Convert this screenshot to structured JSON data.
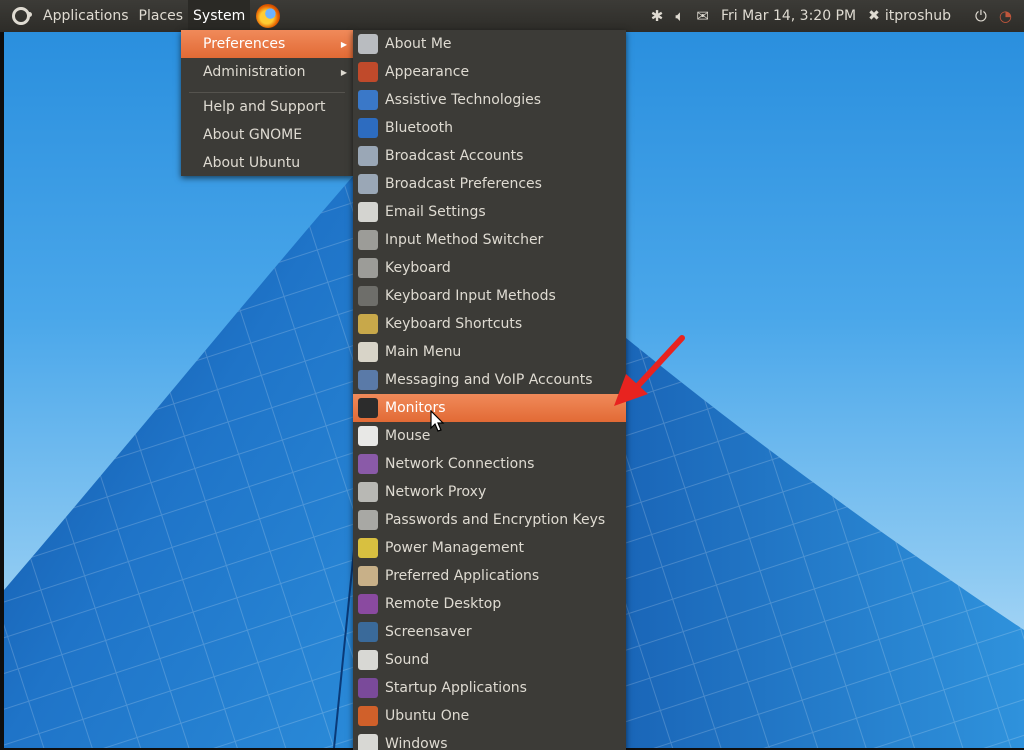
{
  "panel": {
    "applications": "Applications",
    "places": "Places",
    "system": "System",
    "datetime": "Fri Mar 14,  3:20 PM",
    "user": "itproshub"
  },
  "system_menu": {
    "items": [
      {
        "label": "Preferences",
        "has_submenu": true,
        "highlighted": true
      },
      {
        "label": "Administration",
        "has_submenu": true
      },
      {
        "label": "Help and Support"
      },
      {
        "label": "About GNOME"
      },
      {
        "label": "About Ubuntu"
      }
    ]
  },
  "preferences_menu": {
    "items": [
      {
        "label": "About Me",
        "icon": "user-icon",
        "color": "#b9bcc0"
      },
      {
        "label": "Appearance",
        "icon": "appearance-icon",
        "color": "#c04a2b"
      },
      {
        "label": "Assistive Technologies",
        "icon": "accessibility-icon",
        "color": "#3a78c8"
      },
      {
        "label": "Bluetooth",
        "icon": "bluetooth-icon",
        "color": "#2d6cc0"
      },
      {
        "label": "Broadcast Accounts",
        "icon": "broadcast-icon",
        "color": "#9aa7b6"
      },
      {
        "label": "Broadcast Preferences",
        "icon": "broadcast-icon",
        "color": "#9aa7b6"
      },
      {
        "label": "Email Settings",
        "icon": "email-icon",
        "color": "#d4d4d0"
      },
      {
        "label": "Input Method Switcher",
        "icon": "keyboard-icon",
        "color": "#9c9c98"
      },
      {
        "label": "Keyboard",
        "icon": "keyboard-icon",
        "color": "#9c9c98"
      },
      {
        "label": "Keyboard Input Methods",
        "icon": "info-icon",
        "color": "#6e6e6a"
      },
      {
        "label": "Keyboard Shortcuts",
        "icon": "shortcuts-icon",
        "color": "#c8a84a"
      },
      {
        "label": "Main Menu",
        "icon": "main-menu-icon",
        "color": "#d8d4c8"
      },
      {
        "label": "Messaging and VoIP Accounts",
        "icon": "messaging-icon",
        "color": "#5a7aa8"
      },
      {
        "label": "Monitors",
        "icon": "monitor-icon",
        "color": "#2c2c2c",
        "highlighted": true
      },
      {
        "label": "Mouse",
        "icon": "mouse-icon",
        "color": "#e8e8e6"
      },
      {
        "label": "Network Connections",
        "icon": "network-icon",
        "color": "#8a5aa8"
      },
      {
        "label": "Network Proxy",
        "icon": "proxy-icon",
        "color": "#b8b8b4"
      },
      {
        "label": "Passwords and Encryption Keys",
        "icon": "keys-icon",
        "color": "#a8a8a4"
      },
      {
        "label": "Power Management",
        "icon": "power-icon",
        "color": "#d8c040"
      },
      {
        "label": "Preferred Applications",
        "icon": "preferred-apps-icon",
        "color": "#c8b088"
      },
      {
        "label": "Remote Desktop",
        "icon": "remote-desktop-icon",
        "color": "#8a4aa0"
      },
      {
        "label": "Screensaver",
        "icon": "screensaver-icon",
        "color": "#3a6a9a"
      },
      {
        "label": "Sound",
        "icon": "sound-icon",
        "color": "#d8d8d4"
      },
      {
        "label": "Startup Applications",
        "icon": "startup-icon",
        "color": "#7a4a9a"
      },
      {
        "label": "Ubuntu One",
        "icon": "ubuntu-one-icon",
        "color": "#d0602a"
      },
      {
        "label": "Windows",
        "icon": "windows-icon",
        "color": "#d8d8d4"
      }
    ]
  },
  "accent": "#e8703f",
  "annotation_color": "#e8231f"
}
